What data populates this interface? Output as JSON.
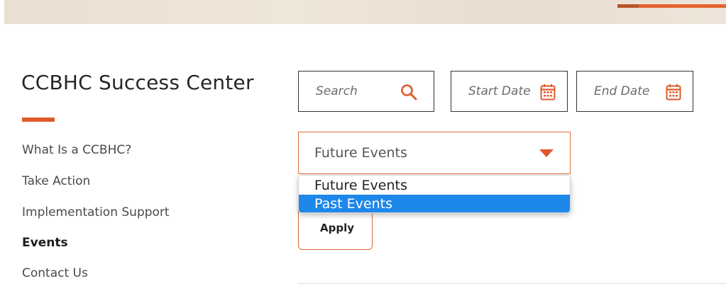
{
  "sidebar": {
    "title": "CCBHC Success Center",
    "items": [
      {
        "label": "What Is a CCBHC?"
      },
      {
        "label": "Take Action"
      },
      {
        "label": "Implementation Support"
      },
      {
        "label": "Events",
        "active": true
      },
      {
        "label": "Contact Us"
      }
    ]
  },
  "filters": {
    "search_placeholder": "Search",
    "start_date_placeholder": "Start Date",
    "end_date_placeholder": "End Date",
    "event_type": {
      "selected": "Future Events",
      "options": [
        "Future Events",
        "Past Events"
      ],
      "highlighted": "Past Events"
    },
    "apply_label": "Apply"
  },
  "icons": {
    "search": "search-icon",
    "calendar": "calendar-icon",
    "caret": "caret-down-icon"
  },
  "colors": {
    "accent": "#e15a2a",
    "highlight": "#1e87ea"
  }
}
